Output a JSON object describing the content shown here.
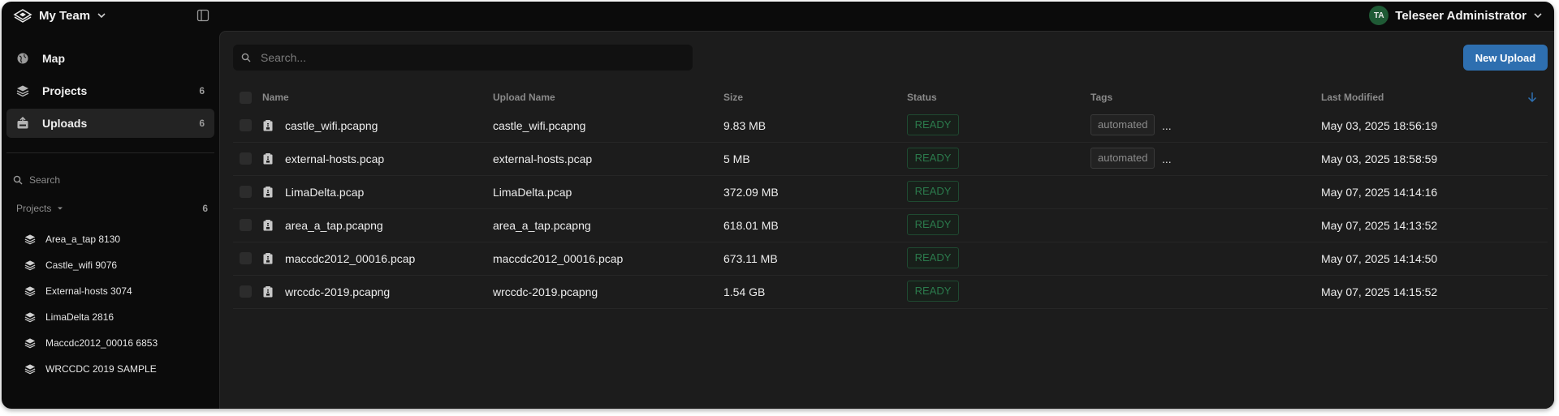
{
  "header": {
    "team_name": "My Team",
    "user_initials": "TA",
    "user_name": "Teleseer Administrator"
  },
  "sidebar": {
    "nav": [
      {
        "label": "Map",
        "count": "",
        "icon": "globe-icon",
        "active": false
      },
      {
        "label": "Projects",
        "count": "6",
        "icon": "layers-icon",
        "active": false
      },
      {
        "label": "Uploads",
        "count": "6",
        "icon": "upload-tray-icon",
        "active": true
      }
    ],
    "search_placeholder": "Search",
    "projects_header": "Projects",
    "projects_count": "6",
    "projects": [
      {
        "label": "Area_a_tap 8130"
      },
      {
        "label": "Castle_wifi 9076"
      },
      {
        "label": "External-hosts 3074"
      },
      {
        "label": "LimaDelta 2816"
      },
      {
        "label": "Maccdc2012_00016 6853"
      },
      {
        "label": "WRCCDC 2019 SAMPLE"
      }
    ]
  },
  "main": {
    "search_placeholder": "Search...",
    "new_upload_label": "New Upload",
    "columns": {
      "name": "Name",
      "upload_name": "Upload Name",
      "size": "Size",
      "status": "Status",
      "tags": "Tags",
      "last_modified": "Last Modified"
    },
    "rows": [
      {
        "name": "castle_wifi.pcapng",
        "upload_name": "castle_wifi.pcapng",
        "size": "9.83 MB",
        "status": "READY",
        "tag": "automated",
        "more": "...",
        "modified": "May 03, 2025 18:56:19"
      },
      {
        "name": "external-hosts.pcap",
        "upload_name": "external-hosts.pcap",
        "size": "5 MB",
        "status": "READY",
        "tag": "automated",
        "more": "...",
        "modified": "May 03, 2025 18:58:59"
      },
      {
        "name": "LimaDelta.pcap",
        "upload_name": "LimaDelta.pcap",
        "size": "372.09 MB",
        "status": "READY",
        "tag": "",
        "more": "",
        "modified": "May 07, 2025 14:14:16"
      },
      {
        "name": "area_a_tap.pcapng",
        "upload_name": "area_a_tap.pcapng",
        "size": "618.01 MB",
        "status": "READY",
        "tag": "",
        "more": "",
        "modified": "May 07, 2025 14:13:52"
      },
      {
        "name": "maccdc2012_00016.pcap",
        "upload_name": "maccdc2012_00016.pcap",
        "size": "673.11 MB",
        "status": "READY",
        "tag": "",
        "more": "",
        "modified": "May 07, 2025 14:14:50"
      },
      {
        "name": "wrccdc-2019.pcapng",
        "upload_name": "wrccdc-2019.pcapng",
        "size": "1.54 GB",
        "status": "READY",
        "tag": "",
        "more": "",
        "modified": "May 07, 2025 14:15:52"
      }
    ]
  },
  "colors": {
    "accent": "#2e6fb0",
    "status_ready": "#2b7a4c",
    "avatar": "#1f5a35"
  }
}
